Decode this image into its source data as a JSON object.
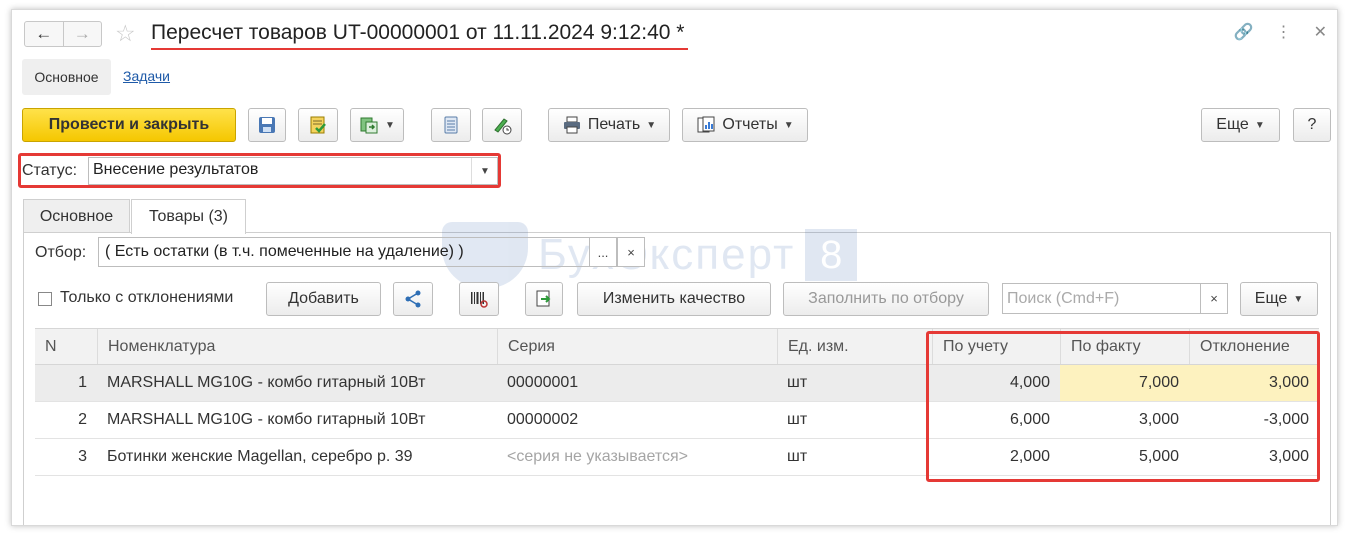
{
  "window": {
    "title": "Пересчет товаров UT-00000001 от 11.11.2024 9:12:40 *",
    "back_glyph": "🡐",
    "forward_glyph": "🡒"
  },
  "sections": {
    "main": "Основное",
    "tasks": "Задачи"
  },
  "toolbar": {
    "post_close": "Провести и закрыть",
    "print": "Печать",
    "reports": "Отчеты",
    "more": "Еще",
    "help": "?"
  },
  "status": {
    "label": "Статус:",
    "value": "Внесение результатов"
  },
  "tabs": {
    "main": "Основное",
    "goods": "Товары (3)"
  },
  "filter": {
    "label": "Отбор:",
    "value": "( Есть остатки (в т.ч. помеченные на удаление) )",
    "dots": "...",
    "clear": "×"
  },
  "actions": {
    "only_deviations": "Только с отклонениями",
    "add": "Добавить",
    "change_quality": "Изменить качество",
    "fill_by_filter": "Заполнить по отбору",
    "search_placeholder": "Поиск (Cmd+F)",
    "search_clear": "×",
    "more": "Еще"
  },
  "watermark": {
    "text": "БухЭксперт",
    "num": "8"
  },
  "table": {
    "headers": [
      "N",
      "Номенклатура",
      "Серия",
      "Ед. изм.",
      "По учету",
      "По факту",
      "Отклонение"
    ],
    "rows": [
      {
        "n": "1",
        "nom": "MARSHALL MG10G - комбо гитарный 10Вт",
        "series": "00000001",
        "unit": "шт",
        "book": "4,000",
        "fact": "7,000",
        "dev": "3,000"
      },
      {
        "n": "2",
        "nom": "MARSHALL MG10G - комбо гитарный 10Вт",
        "series": "00000002",
        "unit": "шт",
        "book": "6,000",
        "fact": "3,000",
        "dev": "-3,000"
      },
      {
        "n": "3",
        "nom": "Ботинки женские Magellan, серебро р. 39",
        "series": "<серия не указывается>",
        "unit": "шт",
        "book": "2,000",
        "fact": "5,000",
        "dev": "3,000"
      }
    ]
  },
  "colors": {
    "accent_red": "#e53935",
    "yellow_button": "#f5c700",
    "highlight": "#fdf2bf",
    "link": "#1e5aa8"
  }
}
